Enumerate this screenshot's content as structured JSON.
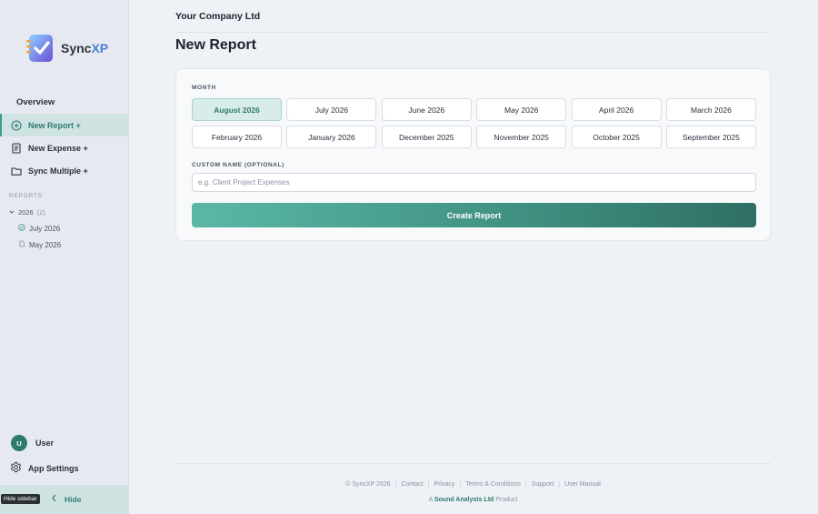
{
  "app": {
    "logo_text": "Sync",
    "logo_text_accent": "XP"
  },
  "sidebar": {
    "overview": "Overview",
    "items": [
      {
        "label": "New Report +",
        "icon": "plus-circle-icon",
        "active": true
      },
      {
        "label": "New Expense +",
        "icon": "document-icon",
        "active": false
      },
      {
        "label": "Sync Multiple +",
        "icon": "folder-icon",
        "active": false
      }
    ],
    "reports_label": "REPORTS",
    "year": "2026",
    "year_count": "(2)",
    "reports": [
      {
        "label": "July 2026",
        "icon": "check-circle-icon"
      },
      {
        "label": "May 2026",
        "icon": "file-icon"
      }
    ],
    "user": {
      "initial": "U",
      "name": "User"
    },
    "settings_label": "App Settings",
    "tooltip": "Hide sidebar",
    "hide_label": "Hide"
  },
  "header": {
    "company": "Your Company Ltd",
    "title": "New Report"
  },
  "form": {
    "month_label": "MONTH",
    "months": [
      "August 2026",
      "July 2026",
      "June 2026",
      "May 2026",
      "April 2026",
      "March 2026",
      "February 2026",
      "January 2026",
      "December 2025",
      "November 2025",
      "October 2025",
      "September 2025"
    ],
    "selected_month": "August 2026",
    "custom_label": "CUSTOM NAME (OPTIONAL)",
    "custom_placeholder": "e.g. Client Project Expenses",
    "custom_value": "",
    "create_label": "Create Report"
  },
  "footer": {
    "copyright": "© SyncXP 2026",
    "links": [
      "Contact",
      "Privacy",
      "Terms & Conditions",
      "Support",
      "User Manual"
    ],
    "by_prefix": "A",
    "by_company": "Sound Analysts Ltd",
    "by_suffix": "Product"
  },
  "colors": {
    "accent": "#2f7a6e",
    "accent_light": "#cfe3e3",
    "button_start": "#5ab8a6",
    "button_end": "#2f6f63"
  }
}
